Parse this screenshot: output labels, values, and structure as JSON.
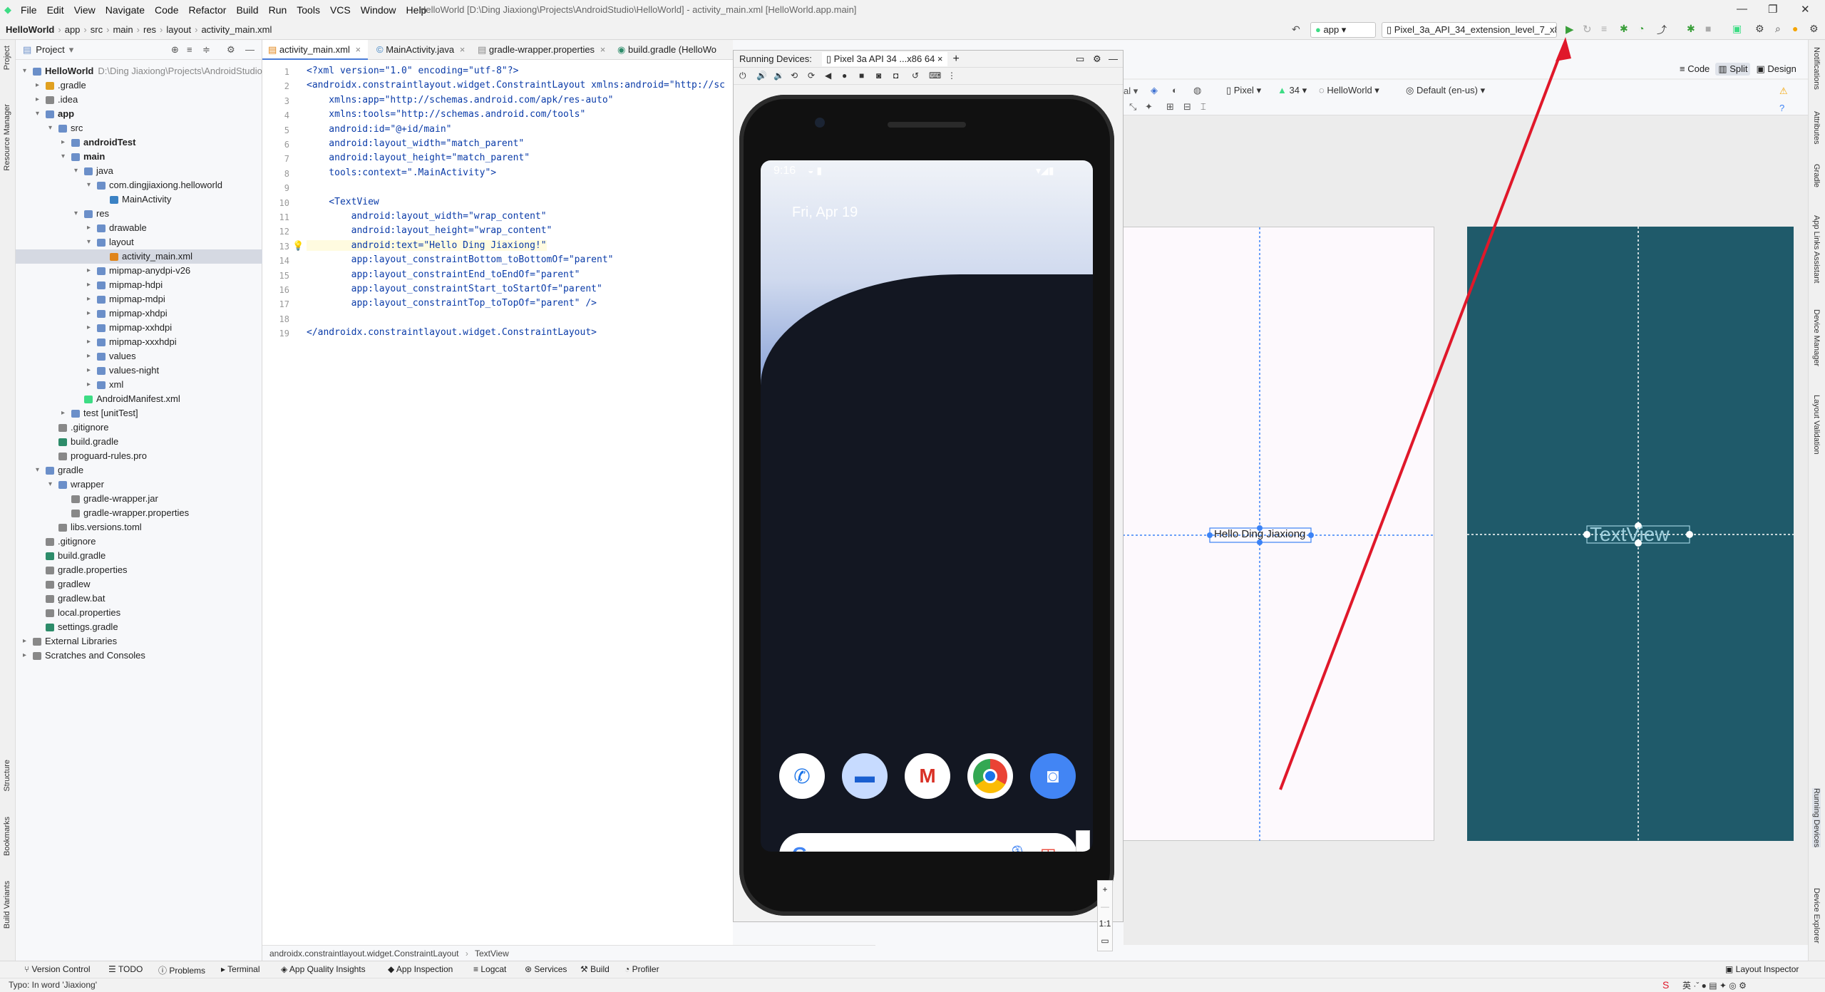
{
  "menu": [
    "File",
    "Edit",
    "View",
    "Navigate",
    "Code",
    "Refactor",
    "Build",
    "Run",
    "Tools",
    "VCS",
    "Window",
    "Help"
  ],
  "window_title": "HelloWorld [D:\\Ding Jiaxiong\\Projects\\AndroidStudio\\HelloWorld] - activity_main.xml [HelloWorld.app.main]",
  "breadcrumb": [
    "HelloWorld",
    "app",
    "src",
    "main",
    "res",
    "layout",
    "activity_main.xml"
  ],
  "toolbar": {
    "run_config": "app",
    "device": "Pixel_3a_API_34_extension_level_7_x8"
  },
  "project_panel": {
    "title": "Project",
    "tree": [
      {
        "label": "HelloWorld",
        "path": "D:\\Ding Jiaxiong\\Projects\\AndroidStudio\\HelloWorld"
      },
      {
        "label": ".gradle"
      },
      {
        "label": ".idea"
      },
      {
        "label": "app"
      },
      {
        "label": "src"
      },
      {
        "label": "androidTest"
      },
      {
        "label": "main"
      },
      {
        "label": "java"
      },
      {
        "label": "com.dingjiaxiong.helloworld"
      },
      {
        "label": "MainActivity"
      },
      {
        "label": "res"
      },
      {
        "label": "drawable"
      },
      {
        "label": "layout"
      },
      {
        "label": "activity_main.xml"
      },
      {
        "label": "mipmap-anydpi-v26"
      },
      {
        "label": "mipmap-hdpi"
      },
      {
        "label": "mipmap-mdpi"
      },
      {
        "label": "mipmap-xhdpi"
      },
      {
        "label": "mipmap-xxhdpi"
      },
      {
        "label": "mipmap-xxxhdpi"
      },
      {
        "label": "values"
      },
      {
        "label": "values-night"
      },
      {
        "label": "xml"
      },
      {
        "label": "AndroidManifest.xml"
      },
      {
        "label": "test [unitTest]"
      },
      {
        "label": ".gitignore"
      },
      {
        "label": "build.gradle"
      },
      {
        "label": "proguard-rules.pro"
      },
      {
        "label": "gradle"
      },
      {
        "label": "wrapper"
      },
      {
        "label": "gradle-wrapper.jar"
      },
      {
        "label": "gradle-wrapper.properties"
      },
      {
        "label": "libs.versions.toml"
      },
      {
        "label": ".gitignore"
      },
      {
        "label": "build.gradle"
      },
      {
        "label": "gradle.properties"
      },
      {
        "label": "gradlew"
      },
      {
        "label": "gradlew.bat"
      },
      {
        "label": "local.properties"
      },
      {
        "label": "settings.gradle"
      },
      {
        "label": "External Libraries"
      },
      {
        "label": "Scratches and Consoles"
      }
    ]
  },
  "editor_tabs": [
    "activity_main.xml",
    "MainActivity.java",
    "gradle-wrapper.properties",
    "build.gradle (HelloWo"
  ],
  "code_lines": [
    "<?xml version=\"1.0\" encoding=\"utf-8\"?>",
    "<androidx.constraintlayout.widget.ConstraintLayout xmlns:android=\"http://sc",
    "    xmlns:app=\"http://schemas.android.com/apk/res-auto\"",
    "    xmlns:tools=\"http://schemas.android.com/tools\"",
    "    android:id=\"@+id/main\"",
    "    android:layout_width=\"match_parent\"",
    "    android:layout_height=\"match_parent\"",
    "    tools:context=\".MainActivity\">",
    "",
    "    <TextView",
    "        android:layout_width=\"wrap_content\"",
    "        android:layout_height=\"wrap_content\"",
    "        android:text=\"Hello Ding Jiaxiong!\"",
    "        app:layout_constraintBottom_toBottomOf=\"parent\"",
    "        app:layout_constraintEnd_toEndOf=\"parent\"",
    "        app:layout_constraintStart_toStartOf=\"parent\"",
    "        app:layout_constraintTop_toTopOf=\"parent\" />",
    "",
    "</androidx.constraintlayout.widget.ConstraintLayout>"
  ],
  "editor_breadcrumb": [
    "androidx.constraintlayout.widget.ConstraintLayout",
    "TextView"
  ],
  "running_devices": {
    "label": "Running Devices:",
    "tab": "Pixel 3a API 34 ...x86 64"
  },
  "phone": {
    "time": "9:16",
    "date": "Fri, Apr 19",
    "zoom": "1:1"
  },
  "design": {
    "modes": [
      "Code",
      "Split",
      "Design"
    ],
    "device": "Pixel",
    "api": "34",
    "theme": "HelloWorld",
    "locale": "Default (en-us)",
    "blueprint_text": "Hello Ding Jiaxiong",
    "textview_text": "TextView"
  },
  "bottom_tools": [
    "Version Control",
    "TODO",
    "Problems",
    "Terminal",
    "App Quality Insights",
    "App Inspection",
    "Logcat",
    "Services",
    "Build",
    "Profiler",
    "Layout Inspector"
  ],
  "left_tools": [
    "Project",
    "Resource Manager",
    "Structure",
    "Bookmarks",
    "Build Variants"
  ],
  "right_tools": [
    "Notifications",
    "Attributes",
    "Gradle",
    "App Links Assistant",
    "Device Manager",
    "Layout Validation",
    "Running Devices",
    "Device Explorer"
  ],
  "status": "Typo: In word 'Jiaxiong'",
  "colors": {
    "accent": "#4a7cd8",
    "blueprint": "#1f5a6a",
    "annotation_arrow": "#e0182a"
  }
}
